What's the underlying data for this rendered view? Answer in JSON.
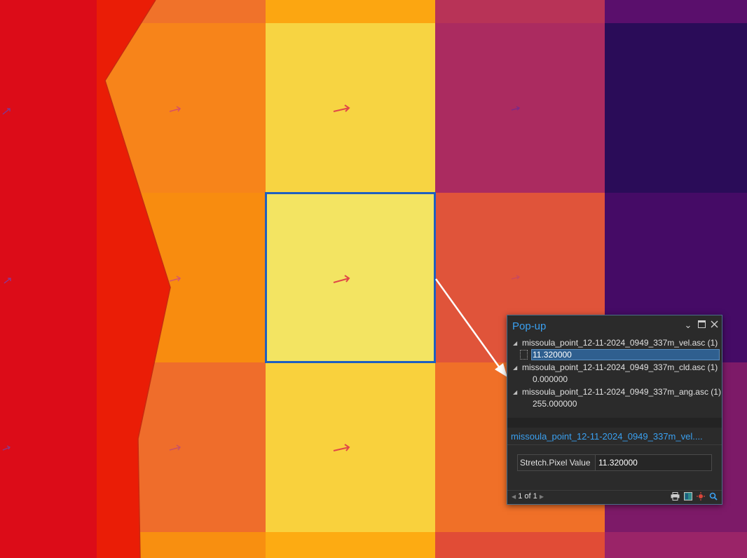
{
  "popup": {
    "title": "Pop-up",
    "icons": {
      "collapse": "chevron-down-icon",
      "maximize": "maximize-icon",
      "close": "close-icon"
    },
    "layers": [
      {
        "name": "missoula_point_12-11-2024_0949_337m_vel.asc (1)",
        "value": "11.320000",
        "selected": true
      },
      {
        "name": "missoula_point_12-11-2024_0949_337m_cld.asc (1)",
        "value": "0.000000",
        "selected": false
      },
      {
        "name": "missoula_point_12-11-2024_0949_337m_ang.asc (1)",
        "value": "255.000000",
        "selected": false
      }
    ],
    "feature_title": "missoula_point_12-11-2024_0949_337m_vel....",
    "fields": [
      {
        "name": "Stretch.Pixel Value",
        "value": "11.320000"
      }
    ],
    "pager": "1 of 1",
    "footer_tools": [
      "print-icon",
      "export-icon",
      "flash-icon",
      "zoom-to-icon"
    ]
  },
  "map": {
    "colors": {
      "red": "#dc0c18",
      "red_orange": "#ea1d06",
      "orange": "#f6840f",
      "yellow": "#f8d241",
      "light_yellow": "#f3e462",
      "magenta": "#ab2b60",
      "coral": "#e0543a",
      "dark_purple": "#2a0c58",
      "purple": "#450b66",
      "selection": "#1e5fc0",
      "arrow": "#e05050"
    }
  }
}
